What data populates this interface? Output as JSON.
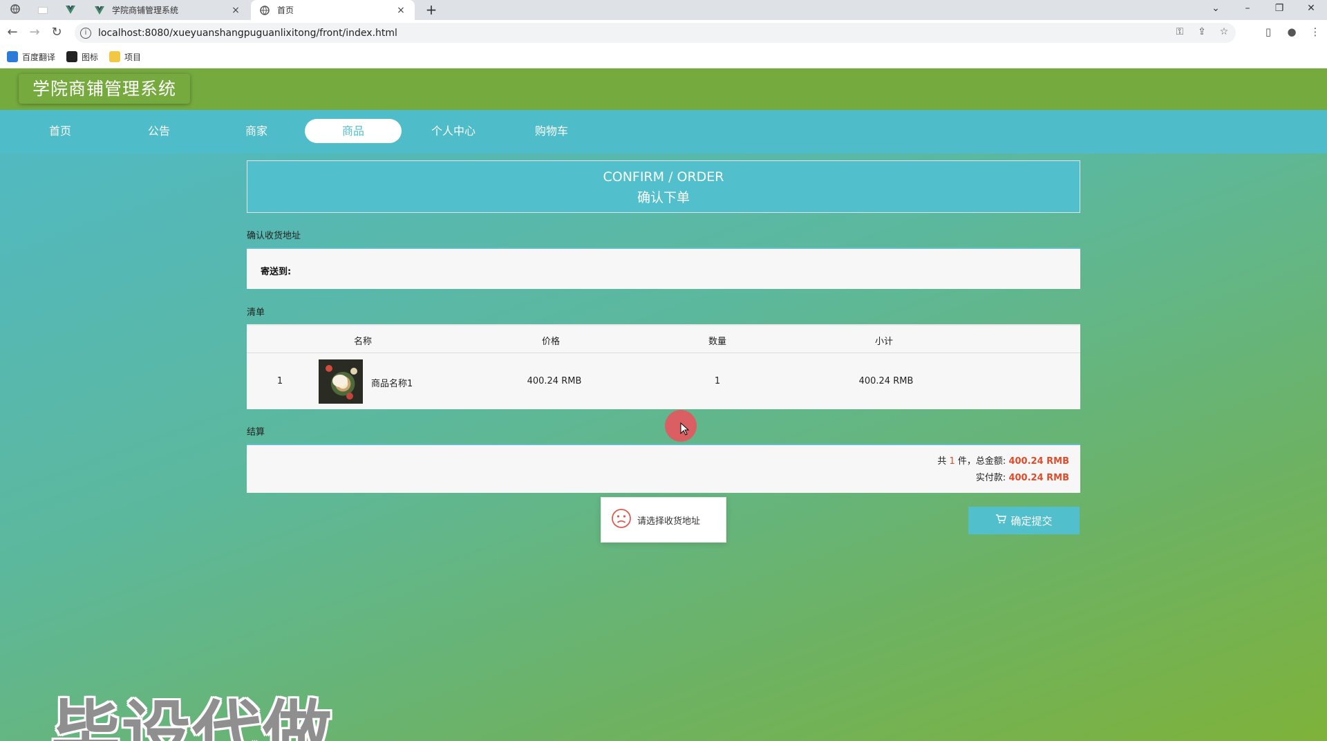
{
  "browser": {
    "tabs": [
      {
        "title": "学院商铺管理系统",
        "close": "×"
      },
      {
        "title": "首页",
        "close": "×"
      }
    ],
    "new_tab": "+",
    "url": "localhost:8080/xueyuanshangpuguanlixitong/front/index.html",
    "bookmarks": [
      {
        "label": "百度翻译",
        "icon": "translate-icon",
        "color": "#2b7bd9"
      },
      {
        "label": "图标",
        "icon": "image-icon",
        "color": "#222222"
      },
      {
        "label": "项目",
        "icon": "folder-icon",
        "color": "#f2c744"
      }
    ]
  },
  "site": {
    "title": "学院商铺管理系统",
    "nav": [
      {
        "label": "首页"
      },
      {
        "label": "公告"
      },
      {
        "label": "商家"
      },
      {
        "label": "商品",
        "active": true
      },
      {
        "label": "个人中心"
      },
      {
        "label": "购物车"
      }
    ]
  },
  "order": {
    "banner_en": "CONFIRM / ORDER",
    "banner_cn": "确认下单",
    "address_section": "确认收货地址",
    "ship_to": "寄送到:",
    "list_section": "清单",
    "columns": [
      "名称",
      "价格",
      "数量",
      "小计"
    ],
    "items": [
      {
        "index": "1",
        "name": "商品名称1",
        "price": "400.24 RMB",
        "qty": "1",
        "subtotal": "400.24 RMB"
      }
    ],
    "checkout_section": "结算",
    "summary": {
      "prefix": "共",
      "count": "1",
      "count_suffix": "件，总金额:",
      "total": "400.24 RMB",
      "paid_label": "实付款:",
      "paid": "400.24 RMB"
    },
    "submit_label": "确定提交"
  },
  "toast": {
    "message": "请选择收货地址",
    "icon": "sad-face-icon"
  },
  "watermark": "毕设代做",
  "colors": {
    "header_green": "#75aa3f",
    "nav_teal": "#4fbcc9",
    "accent_teal": "#52bfcd",
    "price_red": "#e04b2a"
  }
}
